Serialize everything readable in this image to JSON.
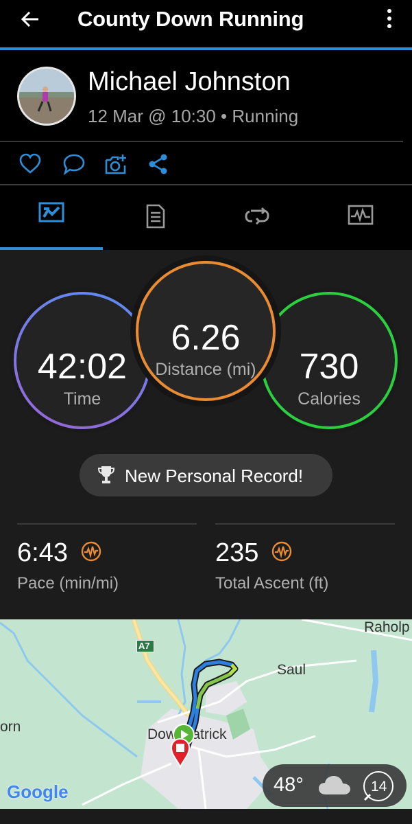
{
  "header": {
    "title": "County Down Running"
  },
  "profile": {
    "name": "Michael Johnston",
    "meta": "12 Mar @ 10:30 • Running"
  },
  "actions": [
    "like-icon",
    "comment-icon",
    "add-photo-icon",
    "share-icon"
  ],
  "tabs": [
    "stats-tab",
    "details-tab",
    "laps-tab",
    "charts-tab"
  ],
  "stats": {
    "time": {
      "value": "42:02",
      "label": "Time"
    },
    "distance": {
      "value": "6.26",
      "label": "Distance (mi)"
    },
    "calories": {
      "value": "730",
      "label": "Calories"
    },
    "personal_record": "New Personal Record!",
    "pace": {
      "value": "6:43",
      "label": "Pace (min/mi)"
    },
    "ascent": {
      "value": "235",
      "label": "Total Ascent (ft)"
    }
  },
  "map": {
    "labels": {
      "road": "A7",
      "place1": "Raholp",
      "place2": "Saul",
      "place3": "orn",
      "place4": "Downpatrick",
      "brand": "Google"
    },
    "weather": {
      "temp": "48°",
      "wind": "14"
    }
  },
  "colors": {
    "accent": "#2e8fd8",
    "time_ring": "#7b7ae6",
    "distance_ring": "#e98c33",
    "calories_ring": "#2bcf40",
    "pulse": "#e98c33"
  }
}
